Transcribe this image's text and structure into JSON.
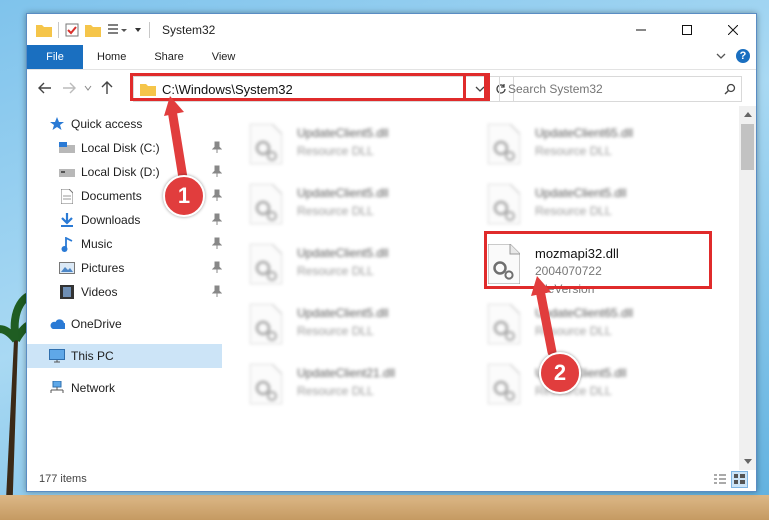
{
  "window": {
    "title": "System32"
  },
  "ribbon": {
    "file": "File",
    "tabs": [
      "Home",
      "Share",
      "View"
    ],
    "help": "?"
  },
  "address": {
    "path": "C:\\Windows\\System32"
  },
  "search": {
    "placeholder": "Search System32"
  },
  "nav": {
    "quick_access": "Quick access",
    "items": [
      "Local Disk (C:)",
      "Local Disk (D:)",
      "Documents",
      "Downloads",
      "Music",
      "Pictures",
      "Videos"
    ],
    "onedrive": "OneDrive",
    "thispc": "This PC",
    "network": "Network"
  },
  "files": {
    "left": [
      {
        "name": "UpdateClient5.dll",
        "type": "Resource DLL"
      },
      {
        "name": "UpdateClient5.dll",
        "type": "Resource DLL"
      },
      {
        "name": "UpdateClient5.dll",
        "type": "Resource DLL"
      },
      {
        "name": "UpdateClient5.dll",
        "type": "Resource DLL"
      },
      {
        "name": "UpdateClient21.dll",
        "type": "Resource DLL"
      }
    ],
    "right": [
      {
        "name": "UpdateClient65.dll",
        "type": "Resource DLL"
      },
      {
        "name": "UpdateClient5.dll",
        "type": "Resource DLL"
      },
      {
        "name": "UpdateClient65.dll",
        "type": "Resource DLL"
      },
      {
        "name": "UpdateClient5.dll",
        "type": "Resource DLL"
      }
    ],
    "highlight": {
      "name": "mozmapi32.dll",
      "version": "2004070722",
      "desc": "FileVersion"
    }
  },
  "status": {
    "count": "177 items"
  },
  "callouts": {
    "one": "1",
    "two": "2"
  },
  "colors": {
    "accent": "#1a6fc0",
    "callout": "#e13d3d",
    "highlight_box": "#e02b2b"
  }
}
